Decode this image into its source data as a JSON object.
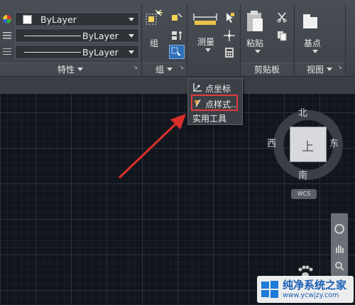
{
  "properties_panel": {
    "title": "特性",
    "color_value": "ByLayer",
    "linetype_value": "ByLayer",
    "lineweight_value": "ByLayer"
  },
  "groups_panel": {
    "title": "组",
    "group_button_label": "组"
  },
  "utilities_panel": {
    "measure_label": "测量",
    "menu_items": [
      "点坐标",
      "点样式...",
      "实用工具"
    ]
  },
  "clipboard_panel": {
    "title": "剪贴板",
    "paste_label": "粘贴"
  },
  "view_panel": {
    "title": "视图",
    "basepoint_label": "基点"
  },
  "viewcube": {
    "north": "北",
    "south": "南",
    "east": "东",
    "west": "西",
    "face": "上",
    "wcs": "WCS"
  },
  "watermark": {
    "title": "纯净系统之家",
    "url": "www.ycwjzy.com"
  },
  "colors": {
    "highlight_red": "#e23a3a",
    "arrow_red": "#d9302c",
    "ribbon_bg": "#44484e",
    "canvas_bg": "#11151c"
  }
}
